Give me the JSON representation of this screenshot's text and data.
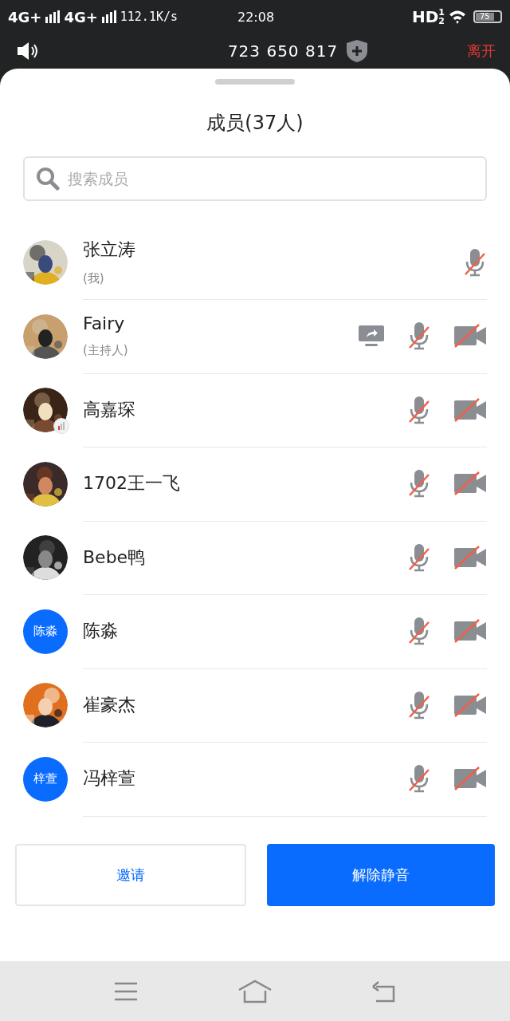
{
  "status_bar": {
    "signal_1": "4G+",
    "signal_2": "4G+",
    "speed": "112.1K/s",
    "time": "22:08",
    "hd": "HD",
    "hd_sup": "1",
    "hd_sub": "2",
    "battery": "75"
  },
  "header": {
    "meeting_id": "723 650 817",
    "leave": "离开"
  },
  "sheet": {
    "title": "成员(37人)",
    "search": {
      "placeholder": "搜索成员"
    }
  },
  "members": [
    {
      "name": "张立涛",
      "subtitle": "(我)",
      "weak_signal": false,
      "sharing_screen": false,
      "mic_muted": true,
      "camera_shown": false
    },
    {
      "name": "Fairy",
      "subtitle": "(主持人)",
      "weak_signal": false,
      "sharing_screen": true,
      "mic_muted": true,
      "camera_shown": true,
      "camera_muted": true
    },
    {
      "name": "高嘉琛",
      "weak_signal": true,
      "sharing_screen": false,
      "mic_muted": true,
      "camera_shown": true,
      "camera_muted": true
    },
    {
      "name": "1702王一飞",
      "weak_signal": false,
      "sharing_screen": false,
      "mic_muted": true,
      "camera_shown": true,
      "camera_muted": true
    },
    {
      "name": "Bebe鸭",
      "weak_signal": false,
      "sharing_screen": false,
      "mic_muted": true,
      "camera_shown": true,
      "camera_muted": true
    },
    {
      "name": "陈淼",
      "avatar": {
        "kind": "initials",
        "text": "陈淼"
      },
      "weak_signal": false,
      "sharing_screen": false,
      "mic_muted": true,
      "camera_shown": true,
      "camera_muted": true
    },
    {
      "name": "崔豪杰",
      "weak_signal": false,
      "sharing_screen": false,
      "mic_muted": true,
      "camera_shown": true,
      "camera_muted": true
    },
    {
      "name": "冯梓萱",
      "avatar": {
        "kind": "initials",
        "text": "梓萱"
      },
      "weak_signal": false,
      "sharing_screen": false,
      "mic_muted": true,
      "camera_shown": true,
      "camera_muted": true
    }
  ],
  "buttons": [
    {
      "label": "邀请",
      "kind": "secondary"
    },
    {
      "label": "解除静音",
      "kind": "primary"
    }
  ]
}
